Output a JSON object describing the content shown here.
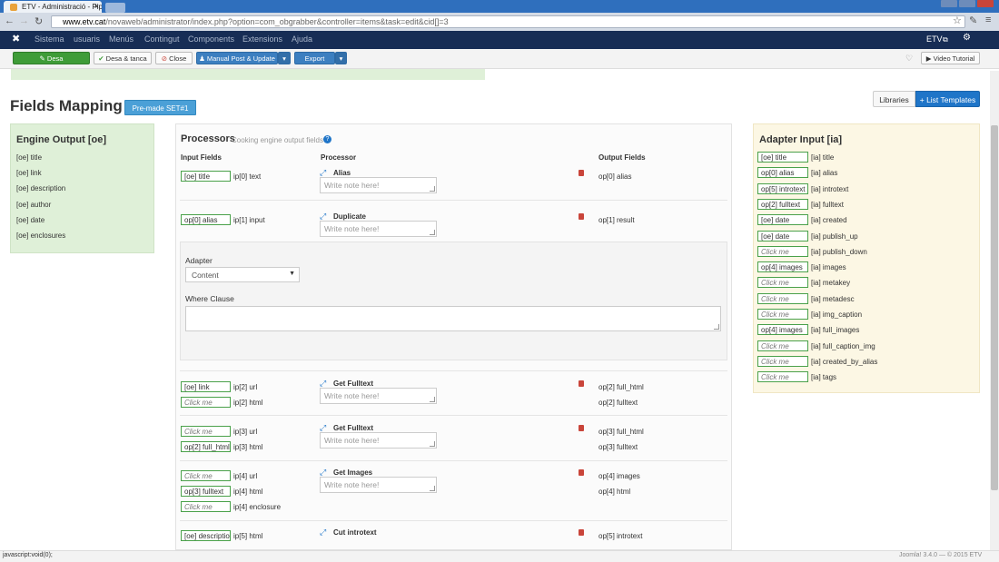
{
  "browser": {
    "tab_title": "ETV - Administració - Pip",
    "url_host": "www.etv.cat",
    "url_rest": "/novaweb/administrator/index.php?option=com_obgrabber&controller=items&task=edit&cid[]=3"
  },
  "menu": {
    "items": [
      "Sistema",
      "usuaris",
      "Menús",
      "Contingut",
      "Components",
      "Extensions",
      "Ajuda"
    ],
    "site": "ETV"
  },
  "toolbar": {
    "save": "Desa",
    "save_close": "Desa & tanca",
    "close": "Close",
    "manual_post": "Manual Post & Update",
    "export": "Export",
    "video_tutorial": "Video Tutorial"
  },
  "header": {
    "title": "Fields Mapping",
    "premade": "Pre-made SET#1",
    "libraries": "Libraries",
    "list_templates": "List Templates"
  },
  "engine": {
    "title": "Engine Output [oe]",
    "items": [
      "[oe] title",
      "[oe] link",
      "[oe] description",
      "[oe] author",
      "[oe] date",
      "[oe] enclosures"
    ]
  },
  "processors": {
    "title": "Processors",
    "subtitle": "Cooking engine output fields",
    "col_input": "Input Fields",
    "col_processor": "Processor",
    "col_output": "Output Fields",
    "note_placeholder": "Write note here!",
    "adapter_label": "Adapter",
    "adapter_value": "Content",
    "where_label": "Where Clause",
    "rows": [
      {
        "inputs": [
          {
            "tag": "[oe] title",
            "label": "ip[0] text"
          }
        ],
        "name": "Alias",
        "outputs": [
          "op[0] alias"
        ]
      },
      {
        "inputs": [
          {
            "tag": "op[0] alias",
            "label": "ip[1] input"
          }
        ],
        "name": "Duplicate",
        "outputs": [
          "op[1] result"
        ]
      },
      {
        "inputs": [
          {
            "tag": "[oe] link",
            "label": "ip[2] url"
          },
          {
            "tag": "Click me",
            "label": "ip[2] html"
          }
        ],
        "name": "Get Fulltext",
        "outputs": [
          "op[2] full_html",
          "op[2] fulltext"
        ]
      },
      {
        "inputs": [
          {
            "tag": "Click me",
            "label": "ip[3] url"
          },
          {
            "tag": "op[2] full_html",
            "label": "ip[3] html"
          }
        ],
        "name": "Get Fulltext",
        "outputs": [
          "op[3] full_html",
          "op[3] fulltext"
        ]
      },
      {
        "inputs": [
          {
            "tag": "Click me",
            "label": "ip[4] url"
          },
          {
            "tag": "op[3] fulltext",
            "label": "ip[4] html"
          },
          {
            "tag": "Click me",
            "label": "ip[4] enclosure"
          }
        ],
        "name": "Get Images",
        "outputs": [
          "op[4] images",
          "op[4] html"
        ]
      },
      {
        "inputs": [
          {
            "tag": "[oe] description",
            "label": "ip[5] html"
          }
        ],
        "name": "Cut introtext",
        "outputs": [
          "op[5] introtext"
        ]
      }
    ]
  },
  "adapter_input": {
    "title": "Adapter Input [ia]",
    "rows": [
      {
        "tag": "[oe] title",
        "label": "[ia] title"
      },
      {
        "tag": "op[0] alias",
        "label": "[ia] alias"
      },
      {
        "tag": "op[5] introtext",
        "label": "[ia] introtext"
      },
      {
        "tag": "op[2] fulltext",
        "label": "[ia] fulltext"
      },
      {
        "tag": "[oe] date",
        "label": "[ia] created"
      },
      {
        "tag": "[oe] date",
        "label": "[ia] publish_up"
      },
      {
        "tag": "Click me",
        "label": "[ia] publish_down"
      },
      {
        "tag": "op[4] images",
        "label": "[ia] images"
      },
      {
        "tag": "Click me",
        "label": "[ia] metakey"
      },
      {
        "tag": "Click me",
        "label": "[ia] metadesc"
      },
      {
        "tag": "Click me",
        "label": "[ia] img_caption"
      },
      {
        "tag": "op[4] images",
        "label": "[ia] full_images"
      },
      {
        "tag": "Click me",
        "label": "[ia] full_caption_img"
      },
      {
        "tag": "Click me",
        "label": "[ia] created_by_alias"
      },
      {
        "tag": "Click me",
        "label": "[ia] tags"
      }
    ]
  },
  "status": {
    "left": "javascript:void(0);",
    "right": "Joomla! 3.4.0 — © 2015 ETV"
  },
  "colors": {
    "joomla_bar": "#172d55",
    "engine_bg": "#dff0d8",
    "adapter_bg": "#fcf7e4",
    "tag_border": "#4aa14a",
    "primary": "#1f75c8"
  }
}
